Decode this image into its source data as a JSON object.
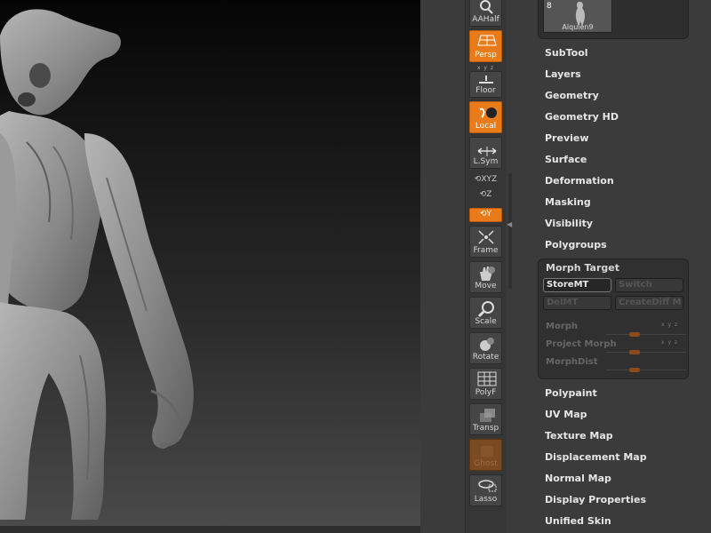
{
  "shelf": {
    "tools": [
      {
        "key": "aahalf",
        "label": "AAHalf",
        "state": "normal",
        "icon": "magnifier-half-icon"
      },
      {
        "key": "persp",
        "label": "Persp",
        "state": "on",
        "icon": "perspective-grid-icon"
      },
      {
        "key": "floor",
        "label": "Floor",
        "state": "normal",
        "icon": "floor-icon"
      },
      {
        "key": "local",
        "label": "Local",
        "state": "on",
        "icon": "local-pivot-icon"
      },
      {
        "key": "lsym",
        "label": "L.Sym",
        "state": "normal",
        "icon": "symmetry-arrows-icon"
      },
      {
        "key": "frame",
        "label": "Frame",
        "state": "normal",
        "icon": "frame-icon"
      },
      {
        "key": "move",
        "label": "Move",
        "state": "normal",
        "icon": "hand-icon"
      },
      {
        "key": "scale",
        "label": "Scale",
        "state": "normal",
        "icon": "magnifier-icon"
      },
      {
        "key": "rotate",
        "label": "Rotate",
        "state": "normal",
        "icon": "rotate-lock-icon"
      },
      {
        "key": "polyf",
        "label": "PolyF",
        "state": "normal",
        "icon": "polyframe-grid-icon"
      },
      {
        "key": "transp",
        "label": "Transp",
        "state": "normal",
        "icon": "transparency-icon"
      },
      {
        "key": "ghost",
        "label": "Ghost",
        "state": "dim",
        "icon": "ghost-icon"
      },
      {
        "key": "lasso",
        "label": "Lasso",
        "state": "normal",
        "icon": "lasso-icon"
      }
    ],
    "floor_axes": "x y z",
    "xyz_label": "XYZ",
    "z_label": "Z",
    "y_label": "Y"
  },
  "palette": {
    "tool_thumb": {
      "count": "8",
      "name": "Alquien9"
    },
    "menus_top": [
      "SubTool",
      "Layers",
      "Geometry",
      "Geometry HD",
      "Preview",
      "Surface",
      "Deformation",
      "Masking",
      "Visibility",
      "Polygroups"
    ],
    "morph_target": {
      "title": "Morph Target",
      "store_mt": "StoreMT",
      "switch": "Switch",
      "del_mt": "DelMT",
      "create_diff": "CreateDiff M",
      "sliders": [
        {
          "label": "Morph",
          "value": 0.35,
          "xyz": "x y z"
        },
        {
          "label": "Project Morph",
          "value": 0.35,
          "xyz": "x y z"
        },
        {
          "label": "MorphDist",
          "value": 0.35
        }
      ]
    },
    "menus_bottom": [
      "Polypaint",
      "UV Map",
      "Texture Map",
      "Displacement Map",
      "Normal Map",
      "Display Properties",
      "Unified Skin"
    ]
  },
  "colors": {
    "accent": "#e97b1a",
    "bg": "#3b3b3b"
  }
}
